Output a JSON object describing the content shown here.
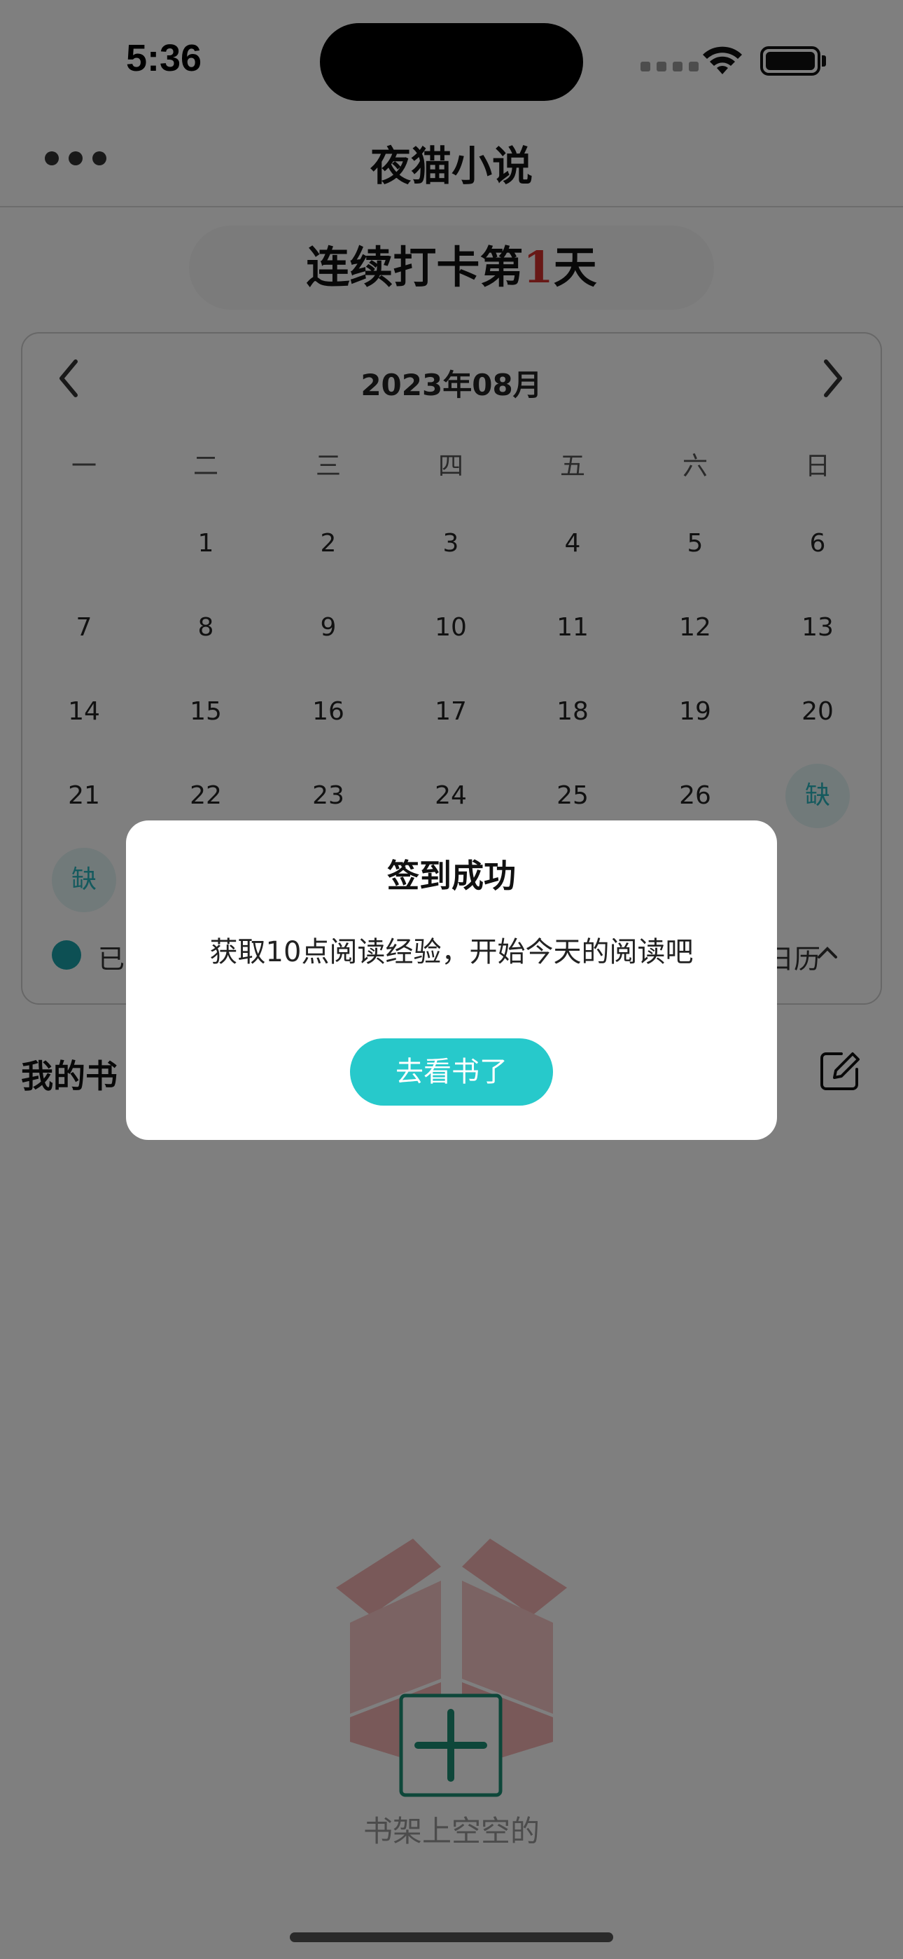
{
  "status_bar": {
    "time": "5:36"
  },
  "nav": {
    "title": "夜猫小说",
    "more_icon": "ellipsis-icon"
  },
  "streak": {
    "prefix": "连续打卡第",
    "count": "1",
    "suffix": "天"
  },
  "calendar": {
    "month": "2023年08月",
    "weekdays": [
      "一",
      "二",
      "三",
      "四",
      "五",
      "六",
      "日"
    ],
    "rows": [
      [
        "",
        "1",
        "2",
        "3",
        "4",
        "5",
        "6"
      ],
      [
        "7",
        "8",
        "9",
        "10",
        "11",
        "12",
        "13"
      ],
      [
        "14",
        "15",
        "16",
        "17",
        "18",
        "19",
        "20"
      ],
      [
        "21",
        "22",
        "23",
        "24",
        "25",
        "26",
        "缺"
      ],
      [
        "缺"
      ]
    ],
    "legend_left": "已",
    "legend_right": "日历",
    "colors": {
      "checked": "#1aa0a8",
      "missed_bg": "#e3f4f5",
      "missed_text": "#2bb5bd"
    }
  },
  "shelf": {
    "title_partial": "我的书",
    "edit_icon": "edit-icon",
    "empty_text": "书架上空空的"
  },
  "dialog": {
    "title": "签到成功",
    "message": "获取10点阅读经验，开始今天的阅读吧",
    "button": "去看书了",
    "accent": "#27c9cb"
  }
}
